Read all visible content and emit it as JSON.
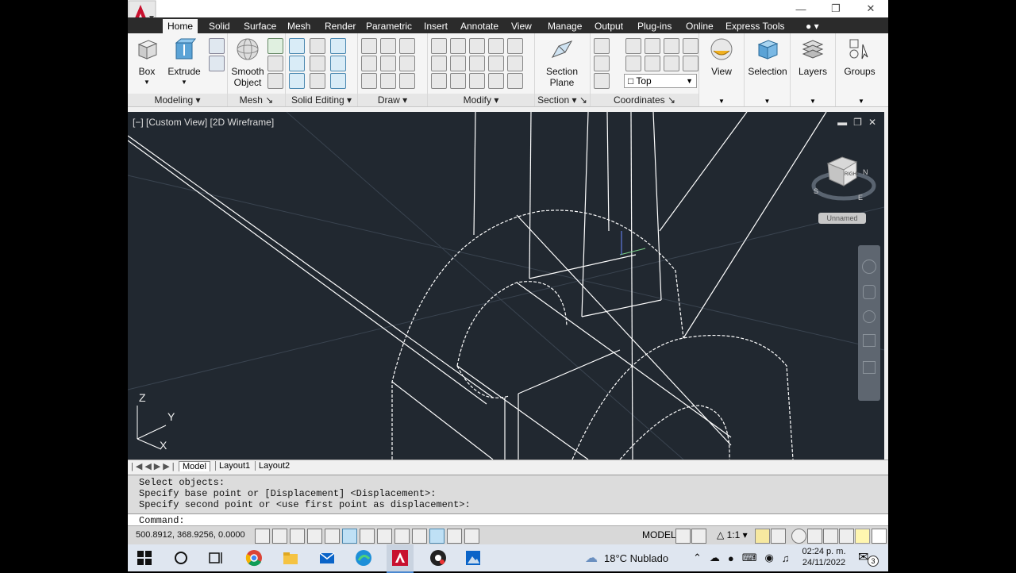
{
  "ribbon": {
    "tabs": [
      "Home",
      "Solid",
      "Surface",
      "Mesh",
      "Render",
      "Parametric",
      "Insert",
      "Annotate",
      "View",
      "Manage",
      "Output",
      "Plug-ins",
      "Online",
      "Express Tools"
    ],
    "active_tab": "Home",
    "buttons": {
      "box": "Box",
      "extrude": "Extrude",
      "smooth_object_1": "Smooth",
      "smooth_object_2": "Object",
      "section_plane_1": "Section",
      "section_plane_2": "Plane",
      "view": "View",
      "selection": "Selection",
      "layers": "Layers",
      "groups": "Groups",
      "top_view_select": "Top"
    },
    "panels": {
      "modeling": "Modeling",
      "mesh": "Mesh",
      "solid_editing": "Solid Editing",
      "draw": "Draw",
      "modify": "Modify",
      "section": "Section",
      "coordinates": "Coordinates"
    }
  },
  "viewport": {
    "label": "[−] [Custom View] [2D Wireframe]",
    "viewcube_face": "RIGHT",
    "viewcube_compass": [
      "S",
      "E",
      "N"
    ],
    "named_view": "Unnamed",
    "ucs": {
      "x": "X",
      "y": "Y",
      "z": "Z"
    }
  },
  "layout_tabs": [
    "Model",
    "Layout1",
    "Layout2"
  ],
  "command": {
    "history": [
      "Select objects:",
      "Specify base point or [Displacement] <Displacement>:",
      "Specify second point or <use first point as displacement>:"
    ],
    "prompt": "Command:"
  },
  "status": {
    "coords": "500.8912, 368.9256, 0.0000",
    "model": "MODEL",
    "scale": "1:1"
  },
  "taskbar": {
    "weather": "18°C  Nublado",
    "time": "02:24 p. m.",
    "date": "24/11/2022",
    "notif_count": "3"
  },
  "colors": {
    "viewport_bg": "#212830",
    "ribbon_tabs_bg": "#2b2b2b",
    "autocad_red": "#c8102e"
  }
}
